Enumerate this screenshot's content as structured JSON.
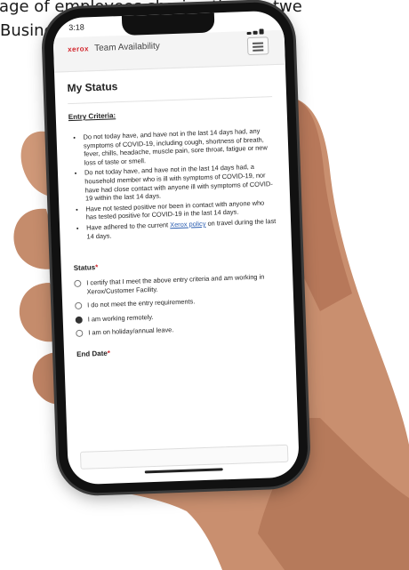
{
  "caption": {
    "line1": "tage of employees sharing time betwe",
    "line2": "Business Wire)"
  },
  "status_bar": {
    "time": "3:18"
  },
  "app": {
    "brand": "xerox",
    "title": "Team Availability"
  },
  "page": {
    "title": "My Status",
    "entry_label": "Entry Criteria:",
    "criteria": [
      "Do not today have, and have not in the last 14 days had, any symptoms of COVID-19, including cough, shortness of breath, fever, chills, headache, muscle pain, sore throat, fatigue or new loss of taste or smell.",
      "Do not today have, and have not in the last 14 days had, a household member who is ill with symptoms of COVID-19, nor have had close contact with anyone ill with symptoms of COVID-19 within the last 14 days.",
      "Have not tested positive nor been in contact with anyone who has tested positive for COVID-19 in the last 14 days."
    ],
    "policy_pre": "Have adhered to the current ",
    "policy_link": "Xerox policy",
    "policy_post": " on travel during the last 14 days.",
    "status_label": "Status",
    "required_mark": "*",
    "options": [
      "I certify that I meet the above entry criteria and am working in Xerox/Customer Facility.",
      "I do not meet the entry requirements.",
      "I am working remotely.",
      "I am on holiday/annual leave."
    ],
    "selected_option": 2,
    "end_date_label": "End Date"
  },
  "colors": {
    "brand": "#d2232a",
    "link": "#2a5db0"
  }
}
